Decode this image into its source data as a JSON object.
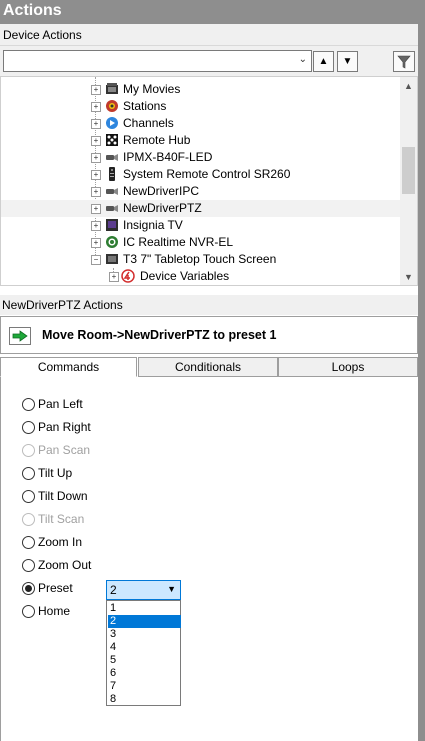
{
  "title": "Actions",
  "device_actions_label": "Device Actions",
  "search": {
    "value": ""
  },
  "tree": {
    "items": [
      {
        "label": "My Movies",
        "icon": "movies-icon"
      },
      {
        "label": "Stations",
        "icon": "stations-icon"
      },
      {
        "label": "Channels",
        "icon": "channels-icon"
      },
      {
        "label": "Remote Hub",
        "icon": "hub-icon"
      },
      {
        "label": "IPMX-B40F-LED",
        "icon": "camera-icon"
      },
      {
        "label": "System Remote Control SR260",
        "icon": "remote-icon"
      },
      {
        "label": "NewDriverIPC",
        "icon": "camera-icon"
      },
      {
        "label": "NewDriverPTZ",
        "icon": "camera-icon"
      },
      {
        "label": "Insignia TV",
        "icon": "tv-icon"
      },
      {
        "label": "IC Realtime NVR-EL",
        "icon": "nvr-icon"
      },
      {
        "label": "T3 7\" Tabletop Touch Screen",
        "icon": "touchscreen-icon"
      },
      {
        "label": "Device Variables",
        "icon": "variables-icon"
      }
    ]
  },
  "actions_header": "NewDriverPTZ Actions",
  "action_title": "Move Room->NewDriverPTZ to preset 1",
  "tabs": [
    "Commands",
    "Conditionals",
    "Loops"
  ],
  "commands": [
    {
      "label": "Pan Left",
      "enabled": true,
      "checked": false
    },
    {
      "label": "Pan Right",
      "enabled": true,
      "checked": false
    },
    {
      "label": "Pan Scan",
      "enabled": false,
      "checked": false
    },
    {
      "label": "Tilt Up",
      "enabled": true,
      "checked": false
    },
    {
      "label": "Tilt Down",
      "enabled": true,
      "checked": false
    },
    {
      "label": "Tilt Scan",
      "enabled": false,
      "checked": false
    },
    {
      "label": "Zoom In",
      "enabled": true,
      "checked": false
    },
    {
      "label": "Zoom Out",
      "enabled": true,
      "checked": false
    },
    {
      "label": "Preset",
      "enabled": true,
      "checked": true
    },
    {
      "label": "Home",
      "enabled": true,
      "checked": false
    }
  ],
  "preset": {
    "selected": "2",
    "options": [
      "1",
      "2",
      "3",
      "4",
      "5",
      "6",
      "7",
      "8"
    ]
  },
  "colors": {
    "title_bar": "#8e8e8e",
    "selection": "#0078d7",
    "select_highlight": "#cce8ff",
    "play_green": "#1fa83a"
  }
}
